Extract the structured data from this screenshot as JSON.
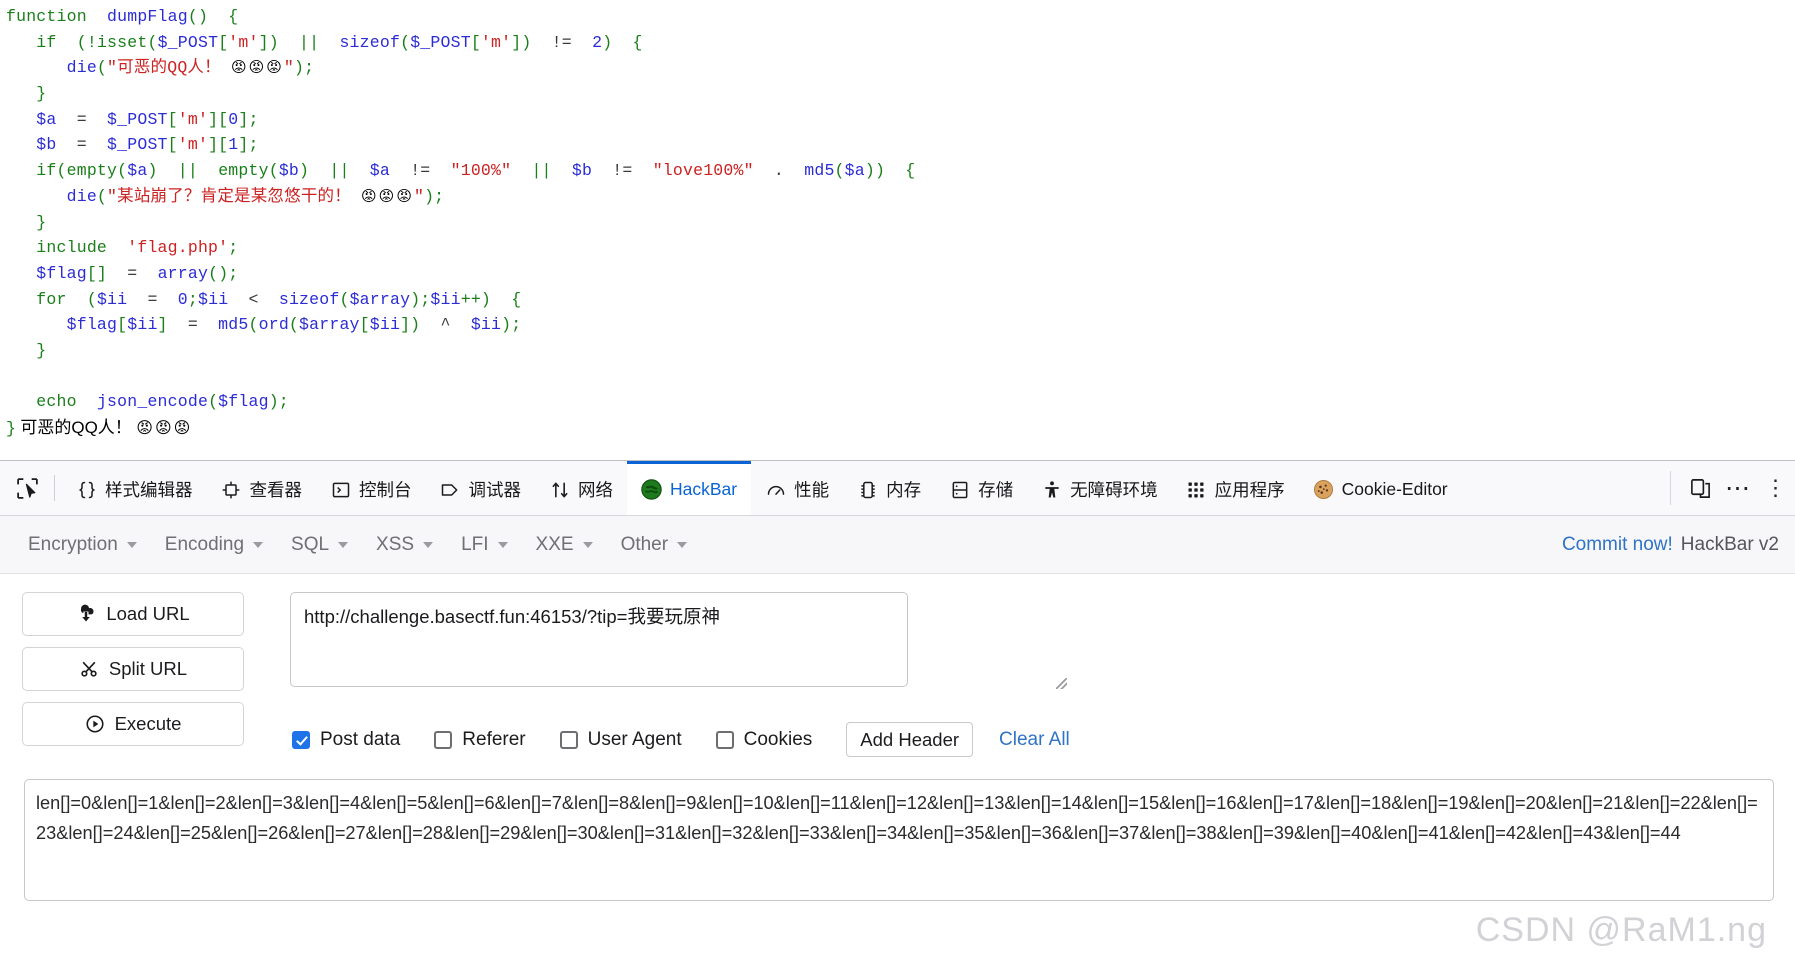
{
  "page": {
    "code_lines": [
      [
        {
          "t": "function ",
          "c": "kw"
        },
        {
          "t": " dumpFlag",
          "c": "fn"
        },
        {
          "t": "()",
          "c": "pun"
        },
        {
          "t": "  {",
          "c": "pun"
        }
      ],
      [
        {
          "t": "   if ",
          "c": "kw"
        },
        {
          "t": " (!",
          "c": "pun"
        },
        {
          "t": "isset",
          "c": "kw"
        },
        {
          "t": "(",
          "c": "pun"
        },
        {
          "t": "$_POST",
          "c": "var"
        },
        {
          "t": "[",
          "c": "pun"
        },
        {
          "t": "'m'",
          "c": "str"
        },
        {
          "t": "])",
          "c": "pun"
        },
        {
          "t": "  ||  ",
          "c": "pun"
        },
        {
          "t": "sizeof",
          "c": "fn"
        },
        {
          "t": "(",
          "c": "pun"
        },
        {
          "t": "$_POST",
          "c": "var"
        },
        {
          "t": "[",
          "c": "pun"
        },
        {
          "t": "'m'",
          "c": "str"
        },
        {
          "t": "])",
          "c": "pun"
        },
        {
          "t": "  != ",
          "c": "op"
        },
        {
          "t": " 2",
          "c": "num"
        },
        {
          "t": ")  {",
          "c": "pun"
        }
      ],
      [
        {
          "t": "      die",
          "c": "fn"
        },
        {
          "t": "(",
          "c": "pun"
        },
        {
          "t": "\"可恶的QQ人！ ",
          "c": "str"
        },
        {
          "t": "😡😡😡",
          "c": "emoji"
        },
        {
          "t": "\"",
          "c": "str"
        },
        {
          "t": ");",
          "c": "pun"
        }
      ],
      [
        {
          "t": "   }",
          "c": "pun"
        }
      ],
      [
        {
          "t": "   $a",
          "c": "var"
        },
        {
          "t": "  = ",
          "c": "op"
        },
        {
          "t": " $_POST",
          "c": "var"
        },
        {
          "t": "[",
          "c": "pun"
        },
        {
          "t": "'m'",
          "c": "str"
        },
        {
          "t": "][",
          "c": "pun"
        },
        {
          "t": "0",
          "c": "num"
        },
        {
          "t": "];",
          "c": "pun"
        }
      ],
      [
        {
          "t": "   $b",
          "c": "var"
        },
        {
          "t": "  = ",
          "c": "op"
        },
        {
          "t": " $_POST",
          "c": "var"
        },
        {
          "t": "[",
          "c": "pun"
        },
        {
          "t": "'m'",
          "c": "str"
        },
        {
          "t": "][",
          "c": "pun"
        },
        {
          "t": "1",
          "c": "num"
        },
        {
          "t": "];",
          "c": "pun"
        }
      ],
      [
        {
          "t": "   if",
          "c": "kw"
        },
        {
          "t": "(",
          "c": "pun"
        },
        {
          "t": "empty",
          "c": "kw"
        },
        {
          "t": "(",
          "c": "pun"
        },
        {
          "t": "$a",
          "c": "var"
        },
        {
          "t": ")",
          "c": "pun"
        },
        {
          "t": "  ||  ",
          "c": "pun"
        },
        {
          "t": "empty",
          "c": "kw"
        },
        {
          "t": "(",
          "c": "pun"
        },
        {
          "t": "$b",
          "c": "var"
        },
        {
          "t": ")",
          "c": "pun"
        },
        {
          "t": "  ||  ",
          "c": "pun"
        },
        {
          "t": "$a",
          "c": "var"
        },
        {
          "t": "  != ",
          "c": "op"
        },
        {
          "t": " \"100%\"",
          "c": "str"
        },
        {
          "t": "  ||  ",
          "c": "pun"
        },
        {
          "t": "$b",
          "c": "var"
        },
        {
          "t": "  != ",
          "c": "op"
        },
        {
          "t": " \"love100%\"",
          "c": "str"
        },
        {
          "t": "  .  ",
          "c": "op"
        },
        {
          "t": "md5",
          "c": "fn"
        },
        {
          "t": "(",
          "c": "pun"
        },
        {
          "t": "$a",
          "c": "var"
        },
        {
          "t": "))",
          "c": "pun"
        },
        {
          "t": "  {",
          "c": "pun"
        }
      ],
      [
        {
          "t": "      die",
          "c": "fn"
        },
        {
          "t": "(",
          "c": "pun"
        },
        {
          "t": "\"某站崩了？肯定是某忽悠干的！ ",
          "c": "str"
        },
        {
          "t": "😡😡😡",
          "c": "emoji"
        },
        {
          "t": "\"",
          "c": "str"
        },
        {
          "t": ");",
          "c": "pun"
        }
      ],
      [
        {
          "t": "   }",
          "c": "pun"
        }
      ],
      [
        {
          "t": "   include ",
          "c": "kw"
        },
        {
          "t": " 'flag.php'",
          "c": "str"
        },
        {
          "t": ";",
          "c": "pun"
        }
      ],
      [
        {
          "t": "   $flag",
          "c": "var"
        },
        {
          "t": "[]",
          "c": "pun"
        },
        {
          "t": "  = ",
          "c": "op"
        },
        {
          "t": " array",
          "c": "fn"
        },
        {
          "t": "();",
          "c": "pun"
        }
      ],
      [
        {
          "t": "   for ",
          "c": "kw"
        },
        {
          "t": " (",
          "c": "pun"
        },
        {
          "t": "$ii",
          "c": "var"
        },
        {
          "t": "  = ",
          "c": "op"
        },
        {
          "t": " 0",
          "c": "num"
        },
        {
          "t": ";",
          "c": "pun"
        },
        {
          "t": "$ii",
          "c": "var"
        },
        {
          "t": "  < ",
          "c": "op"
        },
        {
          "t": " sizeof",
          "c": "fn"
        },
        {
          "t": "(",
          "c": "pun"
        },
        {
          "t": "$array",
          "c": "var"
        },
        {
          "t": ");",
          "c": "pun"
        },
        {
          "t": "$ii",
          "c": "var"
        },
        {
          "t": "++)",
          "c": "pun"
        },
        {
          "t": "  {",
          "c": "pun"
        }
      ],
      [
        {
          "t": "      $flag",
          "c": "var"
        },
        {
          "t": "[",
          "c": "pun"
        },
        {
          "t": "$ii",
          "c": "var"
        },
        {
          "t": "]",
          "c": "pun"
        },
        {
          "t": "  = ",
          "c": "op"
        },
        {
          "t": " md5",
          "c": "fn"
        },
        {
          "t": "(",
          "c": "pun"
        },
        {
          "t": "ord",
          "c": "fn"
        },
        {
          "t": "(",
          "c": "pun"
        },
        {
          "t": "$array",
          "c": "var"
        },
        {
          "t": "[",
          "c": "pun"
        },
        {
          "t": "$ii",
          "c": "var"
        },
        {
          "t": "])",
          "c": "pun"
        },
        {
          "t": "  ^ ",
          "c": "op"
        },
        {
          "t": " $ii",
          "c": "var"
        },
        {
          "t": ");",
          "c": "pun"
        }
      ],
      [
        {
          "t": "   }",
          "c": "pun"
        }
      ],
      [],
      [
        {
          "t": "   echo ",
          "c": "kw"
        },
        {
          "t": " json_encode",
          "c": "fn"
        },
        {
          "t": "(",
          "c": "pun"
        },
        {
          "t": "$flag",
          "c": "var"
        },
        {
          "t": ");",
          "c": "pun"
        }
      ]
    ],
    "output_brace": "}",
    "output_text": "可恶的QQ人！",
    "output_emoji": "😡😡😡"
  },
  "devtools": {
    "picker_icon": "element-picker-icon",
    "tabs": [
      {
        "label": "样式编辑器",
        "icon": "braces-icon",
        "active": false
      },
      {
        "label": "查看器",
        "icon": "inspector-icon",
        "active": false
      },
      {
        "label": "控制台",
        "icon": "console-icon",
        "active": false
      },
      {
        "label": "调试器",
        "icon": "debugger-icon",
        "active": false
      },
      {
        "label": "网络",
        "icon": "network-arrows-icon",
        "active": false
      },
      {
        "label": "HackBar",
        "icon": "hackbar-logo-icon",
        "active": true
      },
      {
        "label": "性能",
        "icon": "performance-gauge-icon",
        "active": false
      },
      {
        "label": "内存",
        "icon": "memory-chip-icon",
        "active": false
      },
      {
        "label": "存储",
        "icon": "storage-icon",
        "active": false
      },
      {
        "label": "无障碍环境",
        "icon": "accessibility-icon",
        "active": false
      },
      {
        "label": "应用程序",
        "icon": "application-grid-icon",
        "active": false
      },
      {
        "label": "Cookie-Editor",
        "icon": "cookie-icon",
        "active": false
      }
    ],
    "right_buttons": [
      {
        "name": "responsive-design-mode-icon"
      },
      {
        "name": "more-options-icon"
      }
    ],
    "active_tab_color": "#0a64d6"
  },
  "hackbar": {
    "menus": [
      "Encryption",
      "Encoding",
      "SQL",
      "XSS",
      "LFI",
      "XXE",
      "Other"
    ],
    "commit_label": "Commit now!",
    "version_label": "HackBar v2",
    "buttons": [
      {
        "label": "Load URL",
        "icon": "load-url-icon"
      },
      {
        "label": "Split URL",
        "icon": "split-url-scissors-icon"
      },
      {
        "label": "Execute",
        "icon": "execute-play-icon"
      }
    ],
    "url_value": "http://challenge.basectf.fun:46153/?tip=我要玩原神",
    "checkboxes": [
      {
        "label": "Post data",
        "checked": true
      },
      {
        "label": "Referer",
        "checked": false
      },
      {
        "label": "User Agent",
        "checked": false
      },
      {
        "label": "Cookies",
        "checked": false
      }
    ],
    "add_header_label": "Add Header",
    "clear_all_label": "Clear All",
    "post_data": "len[]=0&len[]=1&len[]=2&len[]=3&len[]=4&len[]=5&len[]=6&len[]=7&len[]=8&len[]=9&len[]=10&len[]=11&len[]=12&len[]=13&len[]=14&len[]=15&len[]=16&len[]=17&len[]=18&len[]=19&len[]=20&len[]=21&len[]=22&len[]=23&len[]=24&len[]=25&len[]=26&len[]=27&len[]=28&len[]=29&len[]=30&len[]=31&len[]=32&len[]=33&len[]=34&len[]=35&len[]=36&len[]=37&len[]=38&len[]=39&len[]=40&len[]=41&len[]=42&len[]=43&len[]=44"
  },
  "watermark": "CSDN @RaM1.ng"
}
